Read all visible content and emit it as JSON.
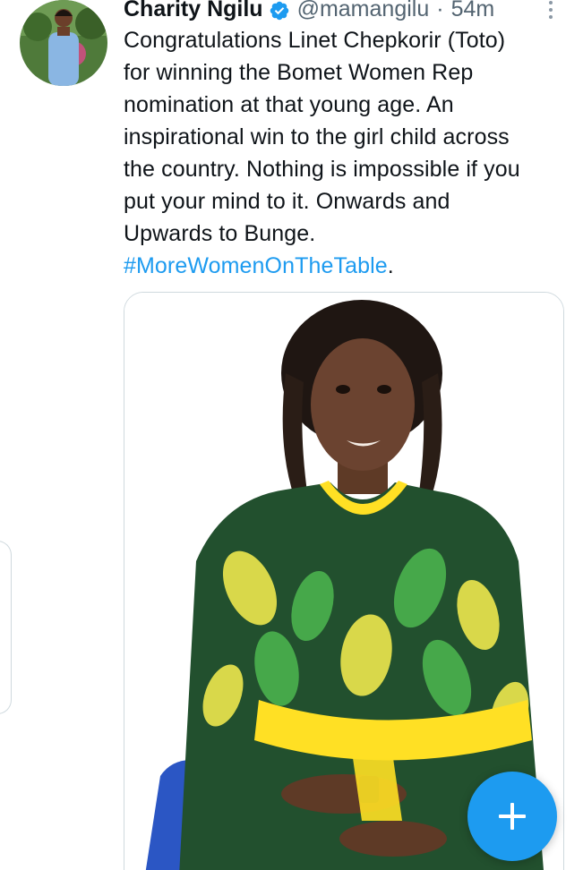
{
  "tweet": {
    "author_name": "Charity Ngilu",
    "handle": "@mamangilu",
    "separator": "·",
    "time": "54m",
    "text": "Congratulations Linet Chepkorir (Toto)\nfor winning the Bomet Women Rep\nnomination at that young age. An\ninspirational win to the girl child across\nthe country. Nothing is impossible if you\nput your mind to it. Onwards and\nUpwards to Bunge.\n",
    "hashtag": "#MoreWomenOnTheTable",
    "trailing": "."
  },
  "icons": {
    "verified": "verified-badge-icon",
    "more": "more-vertical-icon",
    "compose": "plus-icon"
  },
  "colors": {
    "accent": "#1d9bf0",
    "text": "#0f1419",
    "secondary": "#536471",
    "border": "#cfd9de"
  }
}
